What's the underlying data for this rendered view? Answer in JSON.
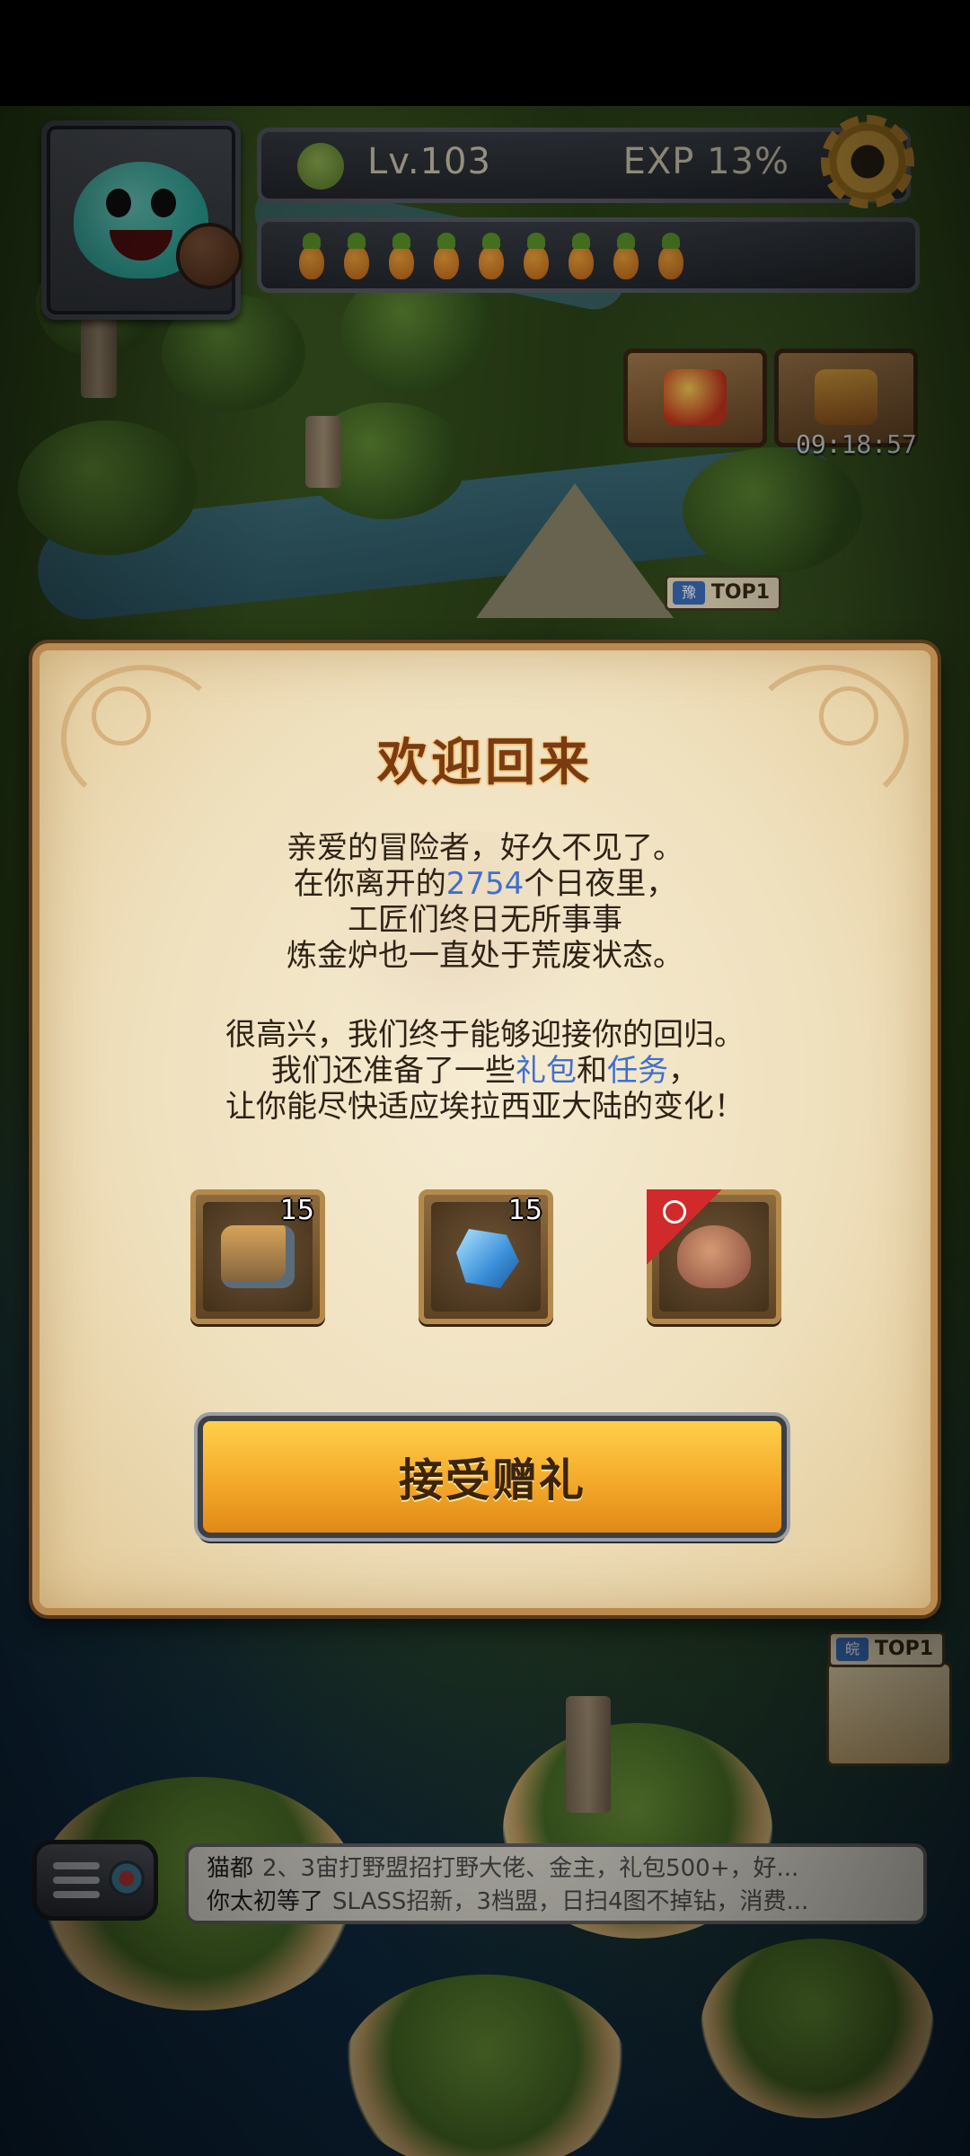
{
  "hud": {
    "level": "Lv.103",
    "exp": "EXP 13%",
    "stamina_count": 9,
    "timer": "09:18:57",
    "top_badges": [
      "TOP1",
      "TOP1"
    ],
    "top_tags": [
      "豫",
      "皖"
    ]
  },
  "dialog": {
    "title": "欢迎回来",
    "para1": {
      "line1": "亲爱的冒险者，好久不见了。",
      "line2_pre": "在你离开的",
      "line2_num": "2754",
      "line2_post": "个日夜里，",
      "line3": "工匠们终日无所事事",
      "line4": "炼金炉也一直处于荒废状态。"
    },
    "para2": {
      "line1": "很高兴，我们终于能够迎接你的回归。",
      "line2_pre": "我们还准备了一些",
      "line2_gift": "礼包",
      "line2_and": "和",
      "line2_task": "任务",
      "line2_post": "，",
      "line3": "让你能尽快适应埃拉西亚大陆的变化！"
    },
    "items": [
      {
        "icon": "machine-icon",
        "count": "15"
      },
      {
        "icon": "crystal-icon",
        "count": "15"
      },
      {
        "icon": "pet-dragon-icon",
        "count": ""
      }
    ],
    "accept_label": "接受赠礼"
  },
  "chat": {
    "messages": [
      {
        "name": "猫都",
        "text": "2、3宙打野盟招打野大佬、金主，礼包500+，好..."
      },
      {
        "name": "你太初等了",
        "text": "SLASS招新，3档盟，日扫4图不掉钻，消费..."
      }
    ]
  },
  "colors": {
    "highlight": "#3f6fd0",
    "title": "#7a3b12",
    "button": "#f4a92a",
    "parchment": "#efe0bd"
  }
}
